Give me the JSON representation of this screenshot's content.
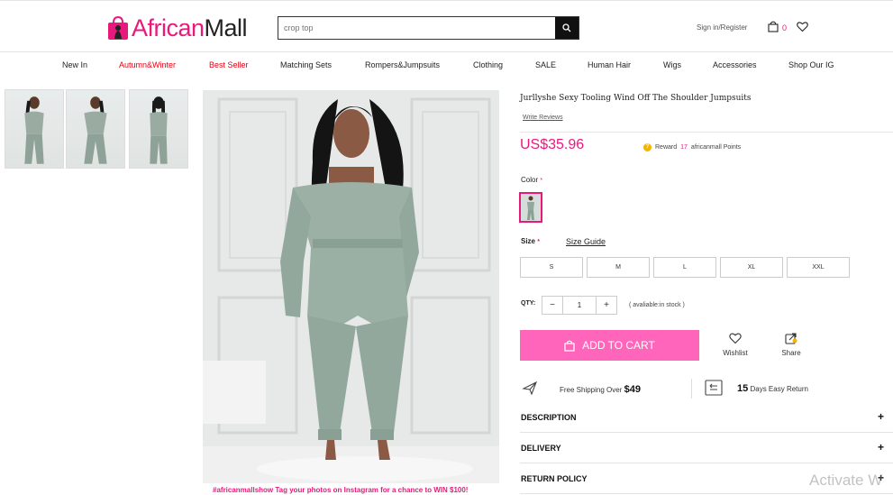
{
  "header": {
    "logo": {
      "part1": "African",
      "part2": "Mall"
    },
    "search_placeholder": "crop top",
    "signin": "Sign in/Register",
    "cart_count": "0"
  },
  "nav": [
    "New In",
    "Autumn&Winter",
    "Best Seller",
    "Matching Sets",
    "Rompers&Jumpsuits",
    "Clothing",
    "SALE",
    "Human Hair",
    "Wigs",
    "Accessories",
    "Shop Our IG"
  ],
  "gallery": {
    "caption": "#africanmallshow Tag your photos on Instagram for a chance to WIN $100!"
  },
  "product": {
    "title": "Jurllyshe Sexy Tooling Wind Off The Shoulder Jumpsuits",
    "review_link": "Write Reviews",
    "price": "US$35.96",
    "reward_prefix": "Reward",
    "reward_points": "17",
    "reward_suffix": "africanmall Points",
    "color_label": "Color",
    "size_label": "Size",
    "size_guide": "Size Guide",
    "sizes": [
      "S",
      "M",
      "L",
      "XL",
      "XXL"
    ],
    "qty_label": "QTY:",
    "qty_minus": "−",
    "qty_value": "1",
    "qty_plus": "+",
    "stock": "( avaliable:in stock )",
    "add_to_cart": "ADD TO CART",
    "wishlist": "Wishlist",
    "share": "Share",
    "shipping_text": "Free Shipping Over",
    "shipping_amount": "$49",
    "return_days": "15",
    "return_text": "Days Easy Return"
  },
  "accordion": [
    "DESCRIPTION",
    "DELIVERY",
    "RETURN POLICY"
  ],
  "watermark": "Activate W",
  "colors": {
    "brand_pink": "#e8197d",
    "cart_button": "#ff66bb",
    "nav_red": "#e60012"
  }
}
